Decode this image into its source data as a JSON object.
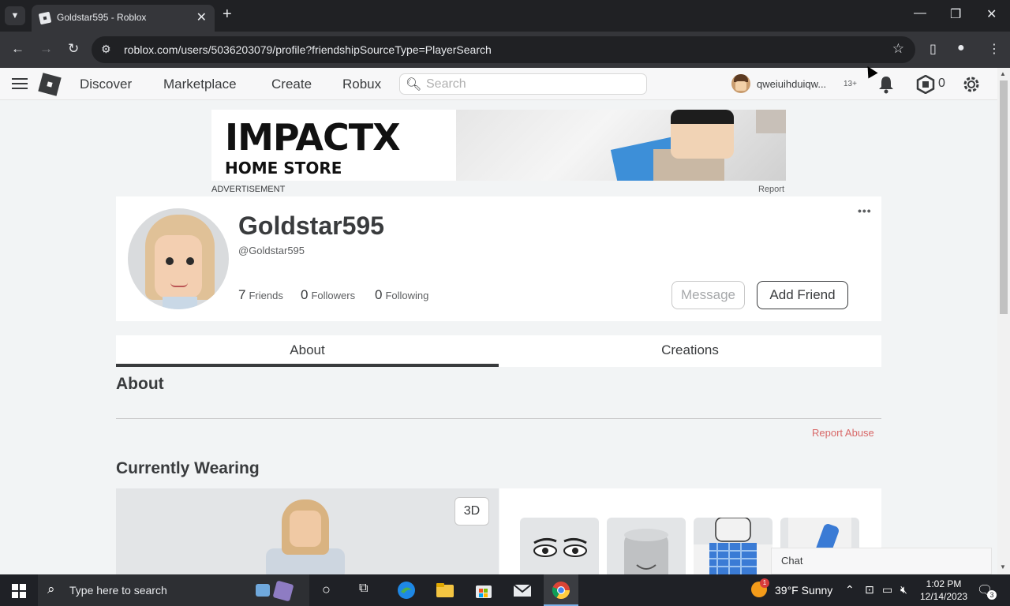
{
  "browser": {
    "tab_title": "Goldstar595 - Roblox",
    "url": "roblox.com/users/5036203079/profile?friendshipSourceType=PlayerSearch"
  },
  "header": {
    "nav": [
      "Discover",
      "Marketplace",
      "Create",
      "Robux"
    ],
    "search_placeholder": "Search",
    "username": "qweiuihduiqw...",
    "age_badge": "13+",
    "robux": "0"
  },
  "ad": {
    "brand_line1": "IMPACTX",
    "brand_line2": "HOME STORE",
    "label": "ADVERTISEMENT",
    "report": "Report"
  },
  "profile": {
    "display_name": "Goldstar595",
    "handle": "@Goldstar595",
    "friends_count": "7",
    "friends_label": "Friends",
    "followers_count": "0",
    "followers_label": "Followers",
    "following_count": "0",
    "following_label": "Following",
    "message_button": "Message",
    "add_friend_button": "Add Friend",
    "more_menu": "..."
  },
  "tabs": [
    "About",
    "Creations"
  ],
  "about": {
    "title": "About",
    "report_abuse": "Report Abuse"
  },
  "wearing": {
    "title": "Currently Wearing",
    "toggle_3d": "3D"
  },
  "chat": {
    "label": "Chat"
  },
  "taskbar": {
    "search_placeholder": "Type here to search",
    "weather": "39°F  Sunny",
    "weather_badge": "1",
    "time": "1:02 PM",
    "date": "12/14/2023",
    "notifications": "3"
  }
}
